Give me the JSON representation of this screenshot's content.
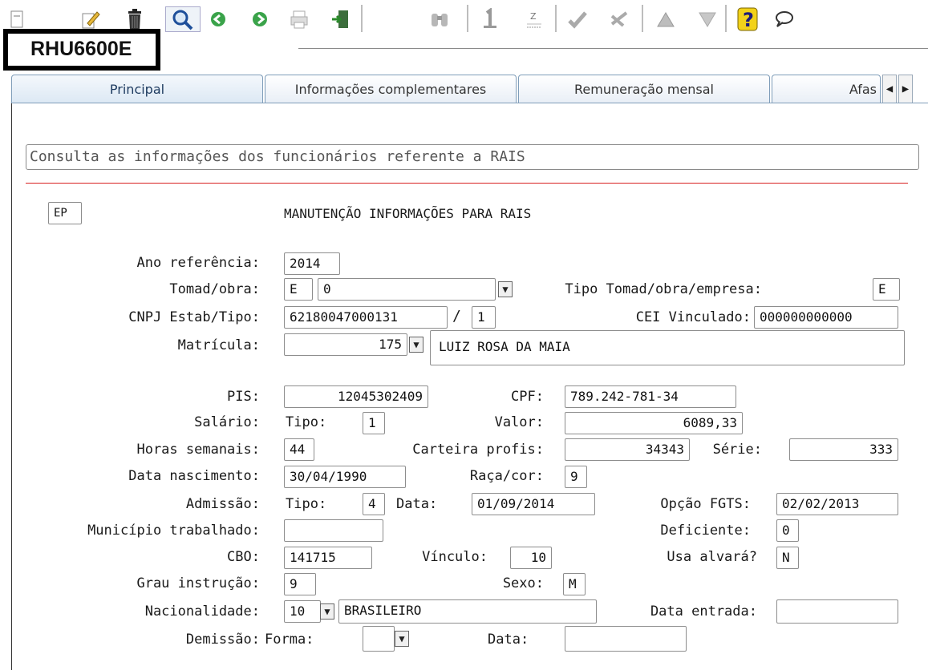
{
  "toolbar": {
    "icons": [
      "new-icon",
      "edit-icon",
      "delete-icon",
      "search-icon",
      "previous-icon",
      "next-icon",
      "print-icon",
      "exit-icon",
      "binoculars-icon",
      "first-icon",
      "zoom-icon",
      "confirm-icon",
      "cancel-icon",
      "up-icon",
      "down-icon",
      "help-icon",
      "comment-icon"
    ],
    "help_glyph": "?"
  },
  "program": {
    "code": "RHU6600E"
  },
  "tabs": [
    {
      "label": "Principal"
    },
    {
      "label": "Informações complementares"
    },
    {
      "label": "Remuneração mensal"
    },
    {
      "label": "Afas"
    }
  ],
  "description": "Consulta as informações dos funcionários referente a RAIS",
  "header": {
    "ep": "EP",
    "title": "MANUTENÇÃO INFORMAÇÕES PARA RAIS"
  },
  "labels": {
    "ano": "Ano referência:",
    "tomad": "Tomad/obra:",
    "tipo_tomad": "Tipo Tomad/obra/empresa:",
    "cnpj": "CNPJ Estab/Tipo:",
    "cei": "CEI Vinculado:",
    "matricula": "Matrícula:",
    "pis": "PIS:",
    "cpf": "CPF:",
    "salario": "Salário:",
    "tipo": "Tipo:",
    "valor": "Valor:",
    "horas": "Horas semanais:",
    "carteira": "Carteira profis:",
    "serie": "Série:",
    "nascimento": "Data nascimento:",
    "raca": "Raça/cor:",
    "admissao": "Admissão:",
    "data": "Data:",
    "opcao_fgts": "Opção FGTS:",
    "municipio": "Município trabalhado:",
    "deficiente": "Deficiente:",
    "cbo": "CBO:",
    "vinculo": "Vínculo:",
    "alvara": "Usa alvará?",
    "grau": "Grau instrução:",
    "sexo": "Sexo:",
    "nacionalidade": "Nacionalidade:",
    "data_entrada": "Data entrada:",
    "demissao": "Demissão:",
    "forma": "Forma:",
    "slash": "/"
  },
  "values": {
    "ano": "2014",
    "tomad_tipo": "E",
    "tomad_obra": "0",
    "tipo_tomad": "E",
    "cnpj": "62180047000131",
    "cnpj_tipo": "1",
    "cei": "000000000000",
    "matricula": "175",
    "nome": "LUIZ ROSA DA MAIA",
    "pis": "12045302409",
    "cpf": "789.242-781-34",
    "salario_tipo": "1",
    "salario_valor": "6089,33",
    "horas": "44",
    "carteira": "34343",
    "serie": "333",
    "nascimento": "30/04/1990",
    "raca": "9",
    "admissao_tipo": "4",
    "admissao_data": "01/09/2014",
    "opcao_fgts": "02/02/2013",
    "municipio": "",
    "deficiente": "0",
    "cbo": "141715",
    "vinculo": "10",
    "alvara": "N",
    "grau": "9",
    "sexo": "M",
    "nacionalidade": "10",
    "nacionalidade_desc": "BRASILEIRO",
    "data_entrada": "",
    "demissao_forma": "",
    "demissao_data": ""
  }
}
